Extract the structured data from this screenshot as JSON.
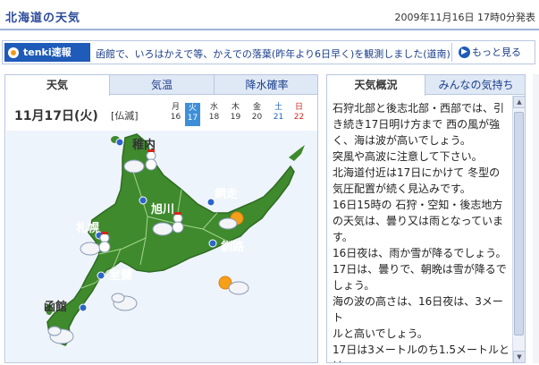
{
  "header": {
    "title": "北海道の天気",
    "issued": "2009年11月16日 17時0分発表"
  },
  "flash": {
    "label": "tenki速報",
    "text": "函館で、いろはかえで等、かえでの落葉(昨年より6日早く)を観測しました(道南)",
    "more": "もっと見る"
  },
  "left": {
    "tabs": [
      "天気",
      "気温",
      "降水確率"
    ],
    "active_tab": "天気",
    "date": "11月17日(火)",
    "rokuyo": "[仏滅]",
    "days": [
      {
        "dow": "月",
        "num": "16"
      },
      {
        "dow": "火",
        "num": "17"
      },
      {
        "dow": "水",
        "num": "18"
      },
      {
        "dow": "木",
        "num": "19"
      },
      {
        "dow": "金",
        "num": "20"
      },
      {
        "dow": "土",
        "num": "21"
      },
      {
        "dow": "日",
        "num": "22"
      }
    ],
    "cities": [
      {
        "name": "稚内",
        "icon": "cloud-snow-icon"
      },
      {
        "name": "旭川",
        "icon": "cloud-snow-icon"
      },
      {
        "name": "網走",
        "icon": "sun-cloud-icon"
      },
      {
        "name": "札幌",
        "icon": "cloud-snow-icon"
      },
      {
        "name": "釧路",
        "icon": "sun-cloud-icon"
      },
      {
        "name": "室蘭",
        "icon": "cloud-icon"
      },
      {
        "name": "函館",
        "icon": "cloud-icon"
      }
    ]
  },
  "right": {
    "tabs": [
      "天気概況",
      "みんなの気持ち"
    ],
    "active_tab": "天気概況",
    "lines": [
      "石狩北部と後志北部・西部では、引",
      "き続き17日明け方まで 西の風が強",
      "く、海は波が高いでしょう。",
      "突風や高波に注意して下さい。",
      "北海道付近は17日にかけて 冬型の",
      "気圧配置が続く見込みです。",
      "16日15時の 石狩・空知・後志地方",
      "の天気は、曇り又は雨となっていま",
      "す。",
      "16日夜は、雨か雪が降るでしょう。",
      "17日は、曇りで、朝晩は雪が降るで",
      "しょう。",
      "海の波の高さは、16日夜は、3メート",
      "ルと高いでしょう。",
      "17日は3メートルのち1.5メートルとは"
    ]
  },
  "colors": {
    "brand_blue": "#1f5bb8",
    "map_land": "#3e8a2d",
    "map_sea": "#e9f1fb",
    "today_blue": "#3f8fd8"
  }
}
